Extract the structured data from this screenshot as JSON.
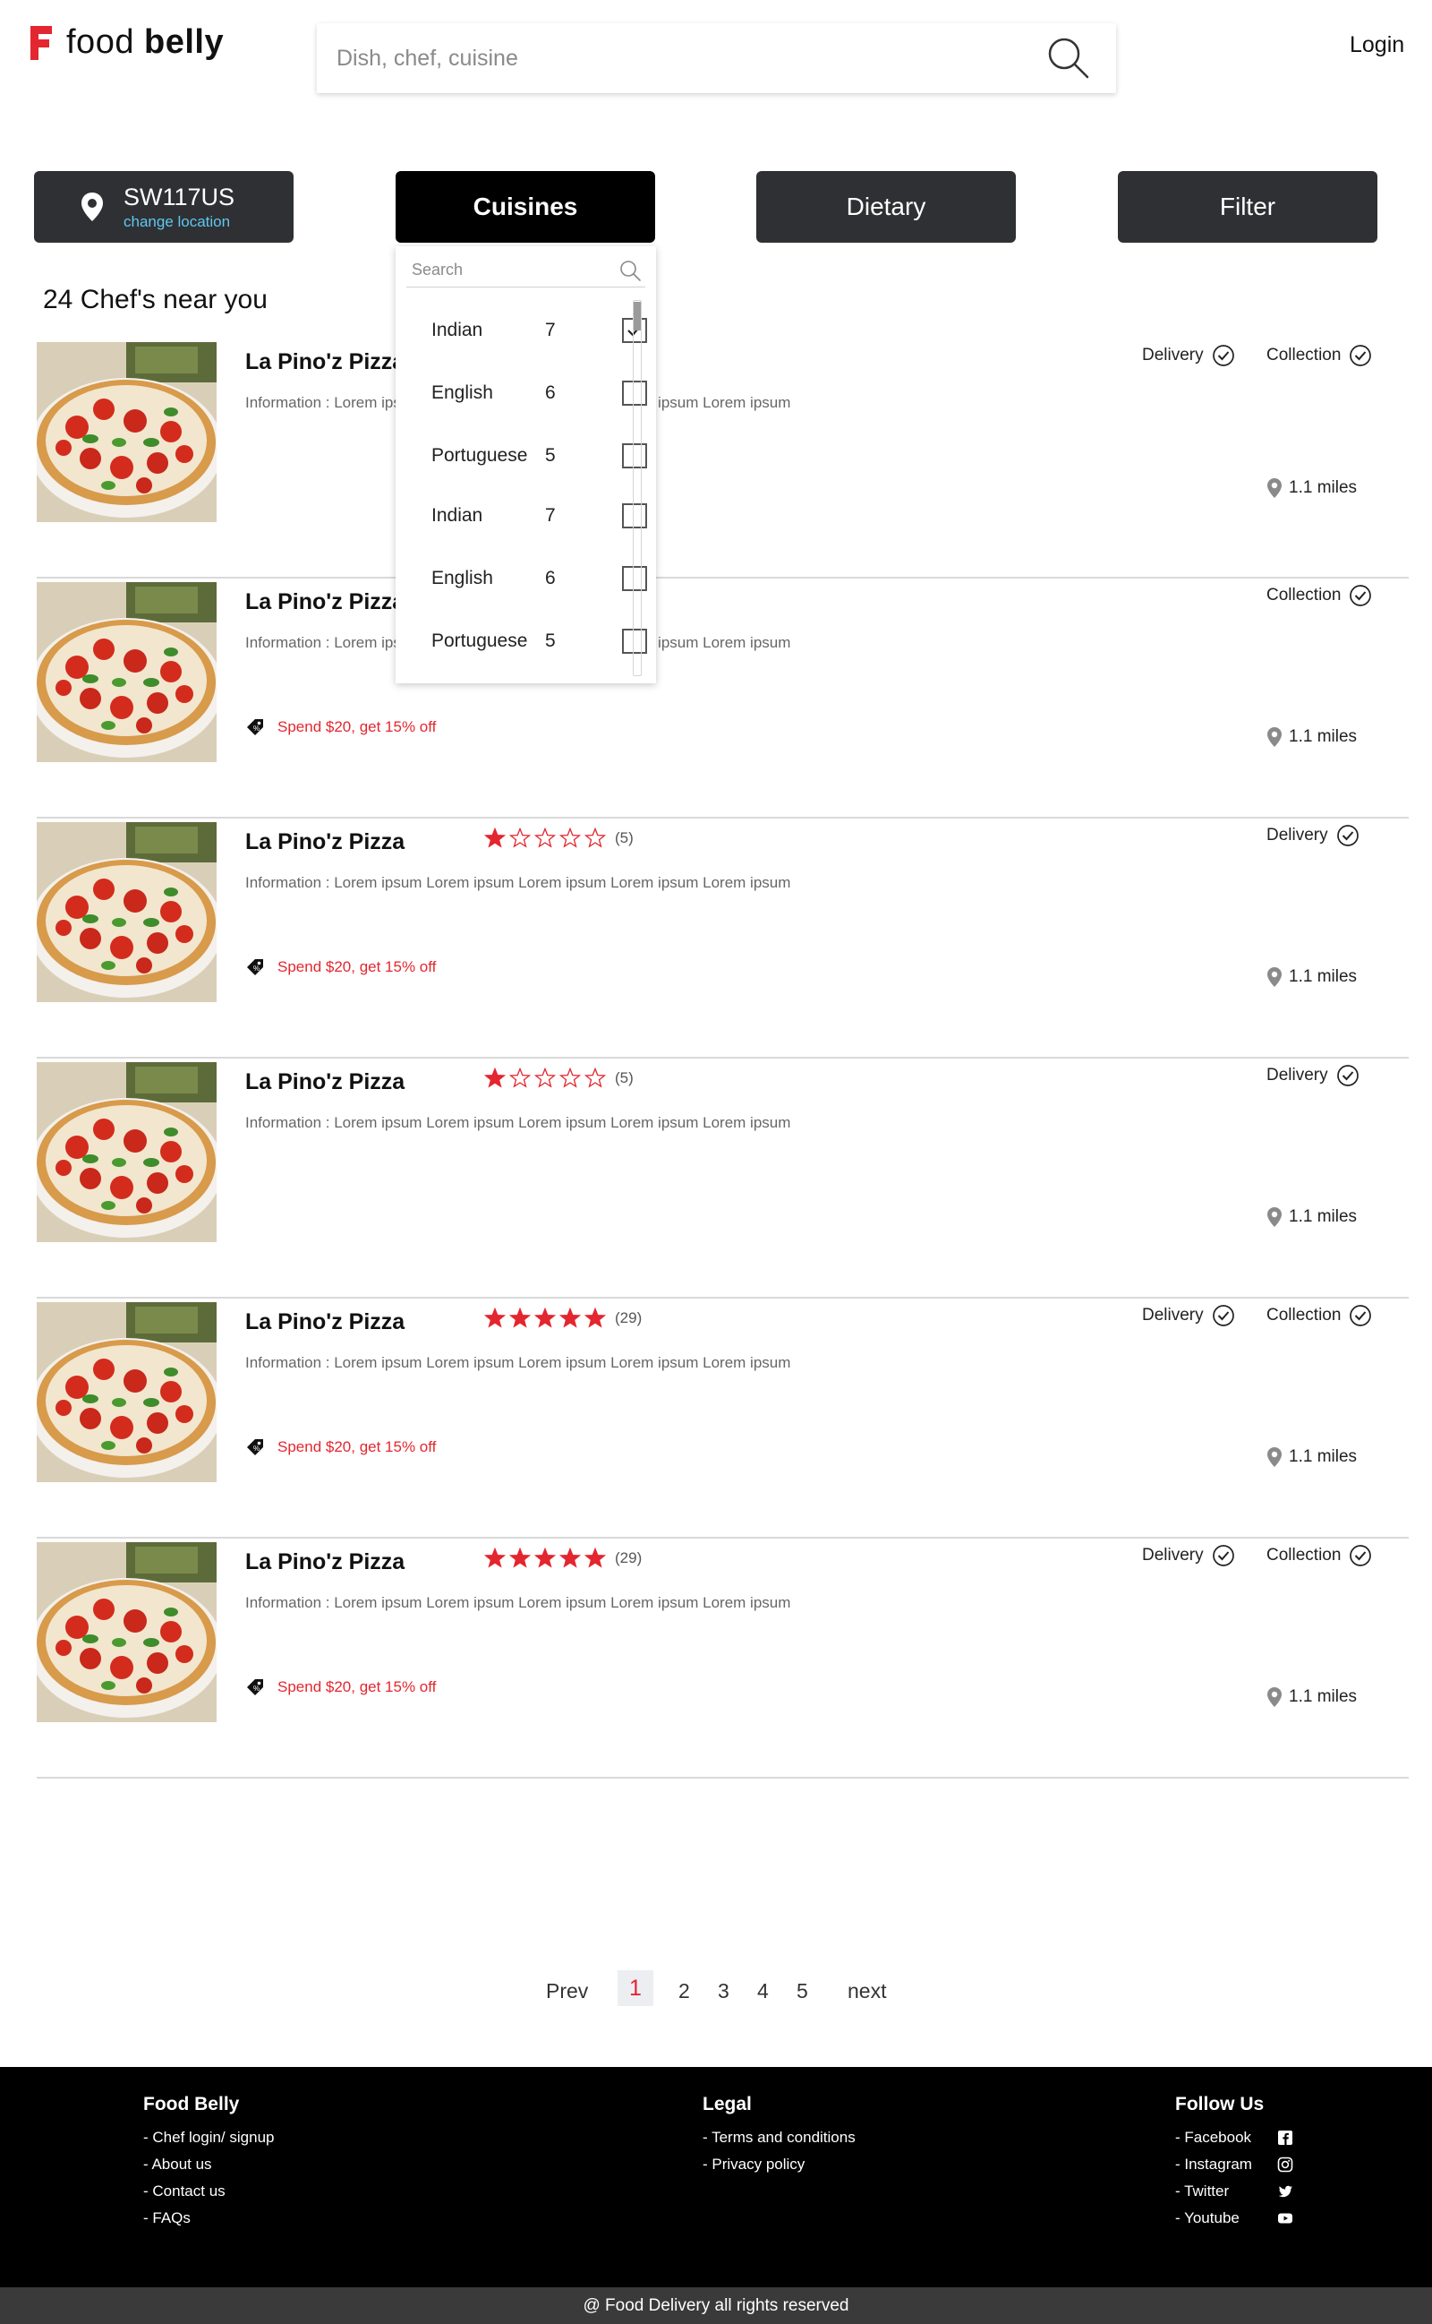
{
  "brand": {
    "name_light": "food",
    "name_bold": "belly",
    "accent": "#e3262f"
  },
  "search": {
    "placeholder": "Dish, chef, cuisine"
  },
  "header": {
    "login_label": "Login"
  },
  "location": {
    "code": "SW117US",
    "change_label": "change location"
  },
  "toolbar": {
    "cuisines_label": "Cuisines",
    "dietary_label": "Dietary",
    "filter_label": "Filter"
  },
  "results": {
    "count_label": "24 Chef's near you"
  },
  "cuisine_dropdown": {
    "search_placeholder": "Search",
    "items": [
      {
        "name": "Indian",
        "count": "7",
        "checked": true
      },
      {
        "name": "English",
        "count": "6",
        "checked": false
      },
      {
        "name": "Portuguese",
        "count": "5",
        "checked": false
      },
      {
        "name": "Indian",
        "count": "7",
        "checked": false
      },
      {
        "name": "English",
        "count": "6",
        "checked": false
      },
      {
        "name": "Portuguese",
        "count": "5",
        "checked": false
      }
    ]
  },
  "listings": [
    {
      "title": "La Pino'z Pizza",
      "info": "Information : Lorem ipsum  Lorem ipsum Lorem ipsum Lorem ipsum Lorem ipsum",
      "rating": 0,
      "rating_count": "",
      "promo": "",
      "delivery": "Delivery",
      "collection": "Collection",
      "distance": "1.1 miles"
    },
    {
      "title": "La Pino'z Pizza",
      "info": "Information : Lorem ipsum  Lorem ipsum Lorem ipsum Lorem ipsum Lorem ipsum",
      "rating": 0,
      "rating_count": "",
      "promo": "Spend $20, get 15% off",
      "delivery": "",
      "collection": "Collection",
      "distance": "1.1 miles"
    },
    {
      "title": "La Pino'z Pizza",
      "info": "Information : Lorem ipsum  Lorem ipsum Lorem ipsum Lorem ipsum Lorem ipsum",
      "rating": 1,
      "rating_count": "(5)",
      "promo": "Spend $20, get 15% off",
      "delivery": "Delivery",
      "collection": "",
      "distance": "1.1 miles"
    },
    {
      "title": "La Pino'z Pizza",
      "info": "Information : Lorem ipsum  Lorem ipsum Lorem ipsum Lorem ipsum Lorem ipsum",
      "rating": 1,
      "rating_count": "(5)",
      "promo": "",
      "delivery": "Delivery",
      "collection": "",
      "distance": "1.1 miles"
    },
    {
      "title": "La Pino'z Pizza",
      "info": "Information : Lorem ipsum  Lorem ipsum Lorem ipsum Lorem ipsum Lorem ipsum",
      "rating": 5,
      "rating_count": "(29)",
      "promo": "Spend $20, get 15% off",
      "delivery": "Delivery",
      "collection": "Collection",
      "distance": "1.1 miles"
    },
    {
      "title": "La Pino'z Pizza",
      "info": "Information : Lorem ipsum  Lorem ipsum Lorem ipsum Lorem ipsum Lorem ipsum",
      "rating": 5,
      "rating_count": "(29)",
      "promo": "Spend $20, get 15% off",
      "delivery": "Delivery",
      "collection": "Collection",
      "distance": "1.1 miles"
    }
  ],
  "pagination": {
    "prev": "Prev",
    "pages": [
      "1",
      "2",
      "3",
      "4",
      "5"
    ],
    "current": "1",
    "next": "next"
  },
  "footer": {
    "col1": {
      "heading": "Food Belly",
      "links": [
        "- Chef login/ signup",
        "- About us",
        "- Contact us",
        "- FAQs"
      ]
    },
    "col2": {
      "heading": "Legal",
      "links": [
        "- Terms and conditions",
        "- Privacy policy"
      ]
    },
    "col3": {
      "heading": "Follow Us",
      "links": [
        {
          "label": "- Facebook",
          "icon": "facebook-icon"
        },
        {
          "label": "- Instagram",
          "icon": "instagram-icon"
        },
        {
          "label": "- Twitter",
          "icon": "twitter-icon"
        },
        {
          "label": "- Youtube",
          "icon": "youtube-icon"
        }
      ]
    },
    "copyright": "@ Food Delivery all rights reserved"
  }
}
